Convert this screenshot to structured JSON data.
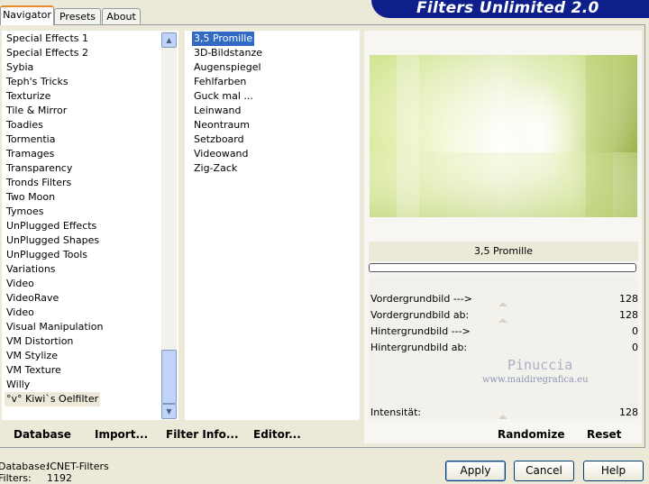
{
  "tabs": [
    "Navigator",
    "Presets",
    "About"
  ],
  "banner_title": "Filters Unlimited 2.0",
  "categories": [
    "Special Effects 1",
    "Special Effects 2",
    "Sybia",
    "Teph's Tricks",
    "Texturize",
    "Tile & Mirror",
    "Toadies",
    "Tormentia",
    "Tramages",
    "Transparency",
    "Tronds Filters",
    "Two Moon",
    "Tymoes",
    "UnPlugged Effects",
    "UnPlugged Shapes",
    "UnPlugged Tools",
    "Variations",
    "Video",
    "VideoRave",
    "Video",
    "Visual Manipulation",
    "VM Distortion",
    "VM Stylize",
    "VM Texture",
    "Willy",
    "°v° Kiwi`s Oelfilter"
  ],
  "selected_category": "°v° Kiwi`s Oelfilter",
  "filters": [
    "3,5 Promille",
    "3D-Bildstanze",
    "Augenspiegel",
    "Fehlfarben",
    "Guck mal ...",
    "Leinwand",
    "Neontraum",
    "Setzboard",
    "Videowand",
    "Zig-Zack"
  ],
  "selected_filter": "3,5 Promille",
  "filter_name": "3,5 Promille",
  "parameters": [
    {
      "label": "Vordergrundbild --->",
      "value": "128"
    },
    {
      "label": "Vordergrundbild ab:",
      "value": "128"
    },
    {
      "label": "Hintergrundbild --->",
      "value": "0"
    },
    {
      "label": "Hintergrundbild ab:",
      "value": "0"
    }
  ],
  "intensity": {
    "label": "Intensität:",
    "value": "128"
  },
  "watermark": {
    "name": "Pinuccia",
    "url": "www.maidiregrafica.eu"
  },
  "bottom_links": {
    "database": "Database",
    "import": "Import...",
    "filter_info": "Filter Info...",
    "editor": "Editor...",
    "randomize": "Randomize",
    "reset": "Reset"
  },
  "status": {
    "database_label": "Database:",
    "database_value": "ICNET-Filters",
    "filters_label": "Filters:",
    "filters_value": "1192"
  },
  "buttons": {
    "apply": "Apply",
    "cancel": "Cancel",
    "help": "Help"
  },
  "colors": {
    "accent_blue": "#0e1f8c",
    "selection": "#316ac5",
    "tab_highlight": "#e68b2c"
  }
}
